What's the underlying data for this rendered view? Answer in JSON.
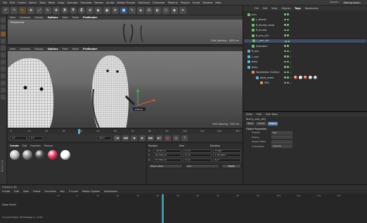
{
  "menubar": {
    "items": [
      "File",
      "Edit",
      "Create",
      "Select",
      "Tools",
      "Mesh",
      "Snap",
      "Animate",
      "Simulate",
      "Render",
      "Sculpt",
      "Motion Tracker",
      "MoGraph",
      "Character",
      "Pipeline",
      "Plugins",
      "Script",
      "Window",
      "Help"
    ],
    "layout_label": "Layout:",
    "layout_value": "Startup (User)"
  },
  "toolbar": {
    "axis_buttons": [
      "X",
      "Y",
      "Z"
    ]
  },
  "viewport_top": {
    "menu": [
      "View",
      "Cameras",
      "Display",
      "Options",
      "Filter",
      "Panel",
      "ProRender"
    ],
    "name": "Perspective",
    "grid_spacing": "Grid Spacing : 1000 cm"
  },
  "viewport_main": {
    "menu": [
      "View",
      "Cameras",
      "Display",
      "Options",
      "Filter",
      "Panel",
      "ProRender"
    ],
    "grid_spacing": "Grid Spacing : 100 cm",
    "axis_readout": "4.58 cm"
  },
  "timeline_ruler": {
    "ticks": [
      "0",
      "10",
      "20",
      "30",
      "40",
      "50",
      "60",
      "70",
      "80",
      "90",
      "100",
      "110",
      "120"
    ],
    "frame_end": "36 F"
  },
  "transport": {
    "start": "0 F",
    "current": "0 F",
    "end": "135 F",
    "buttons": [
      "|◀",
      "◀◀",
      "◀",
      "▶",
      "▶▶",
      "▶|",
      "●",
      "◎",
      "?"
    ]
  },
  "materials": {
    "menu": [
      "Create",
      "Edit",
      "Function",
      "Texture"
    ],
    "swatches": [
      "#bdbdbd",
      "#8a8a8a",
      "#4a4a4a",
      "#e6335a",
      "#ffffff"
    ]
  },
  "coords": {
    "headers": [
      "Position",
      "Size",
      "Rotation"
    ],
    "rows": [
      {
        "axis": "X",
        "pos": "-34.05 cm",
        "size": "0 cm",
        "rot": "H  180 °"
      },
      {
        "axis": "Y",
        "pos": "94.708 cm",
        "size": "0 cm",
        "rot": "P  -87.063 °"
      },
      {
        "axis": "Z",
        "pos": "57.754 cm",
        "size": "0 cm",
        "rot": "B  0 °"
      }
    ],
    "mode": "Object (Rel)",
    "size_mode": "Size",
    "apply": "Apply"
  },
  "timeline": {
    "title": "Timeline (D)",
    "menu": [
      "Create",
      "Edit",
      "View",
      "Frame",
      "Functions",
      "Key",
      "F-Curve",
      "Motion System",
      "Bookmarks"
    ],
    "ticks": [
      "-10",
      "0",
      "10",
      "20",
      "30",
      "40",
      "50",
      "60",
      "70",
      "80",
      "90",
      "100",
      "110",
      "120",
      "130"
    ],
    "sheet_label": "Dope Sheet",
    "status": "Current Frame: 36    Preview: 0-->135"
  },
  "object_manager": {
    "menu": [
      "File",
      "Edit",
      "View",
      "Objects",
      "Tags",
      "Bookmarks"
    ],
    "objects": [
      {
        "name": "arm",
        "type": "green",
        "indent": 0
      },
      {
        "name": "L_thumb",
        "type": "green",
        "indent": 1
      },
      {
        "name": "R_thumb_cloud",
        "type": "green",
        "indent": 1
      },
      {
        "name": "R_thumb",
        "type": "green",
        "indent": 1
      },
      {
        "name": "R_arm_ctrl",
        "type": "green",
        "indent": 1
      },
      {
        "name": "L_arm_ctrl",
        "type": "green",
        "indent": 1
      },
      {
        "name": "extension",
        "type": "green",
        "indent": 1
      },
      {
        "name": "R_eye",
        "type": "cyan",
        "indent": 0
      },
      {
        "name": "L_eye",
        "type": "cyan",
        "indent": 0
      },
      {
        "name": "body",
        "type": "cyan",
        "indent": 0
      },
      {
        "name": "body",
        "type": "cyan",
        "indent": 0
      },
      {
        "name": "Subdivision Surface",
        "type": "orange",
        "indent": 1
      },
      {
        "name": "body_mesh",
        "type": "cyan",
        "indent": 2
      },
      {
        "name": "Skin",
        "type": "orange",
        "indent": 3
      }
    ],
    "tag_colors": [
      "#e05050",
      "#ffffff",
      "#d04040",
      "#e0e0e0",
      "#c0c0c0"
    ]
  },
  "attributes": {
    "menu": [
      "Mode",
      "Edit",
      "User Data"
    ],
    "name": "Null [L_arm_ctrl]",
    "tabs": [
      "Basic",
      "Coord.",
      "Object"
    ],
    "section": "Object Properties",
    "props": [
      {
        "label": "Display",
        "value": "Dot"
      },
      {
        "label": "Radius",
        "value": ""
      },
      {
        "label": "Aspect Ratio",
        "value": ""
      },
      {
        "label": "Orientation",
        "value": "Camera"
      }
    ]
  }
}
